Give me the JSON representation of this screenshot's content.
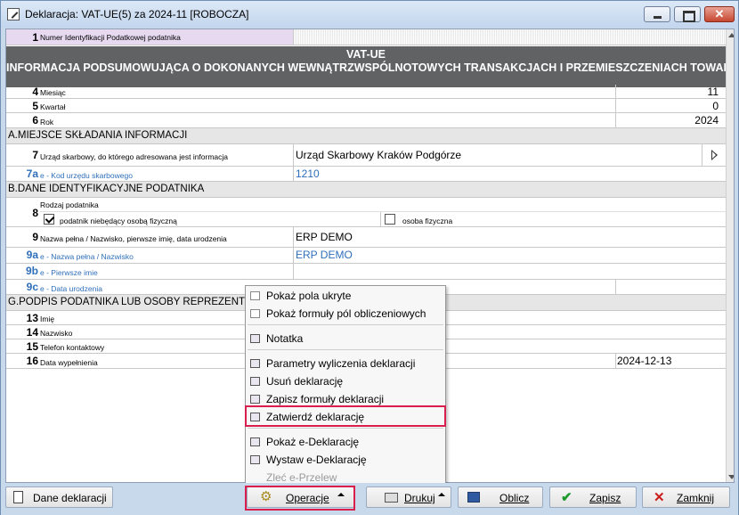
{
  "window": {
    "title": "Deklaracja: VAT-UE(5) za 2024-11  [ROBOCZA]"
  },
  "form": {
    "row1": {
      "num": "1",
      "label": "Numer Identyfikacji Podatkowej podatnika"
    },
    "header_title": "VAT-UE",
    "header_subtitle": "INFORMACJA PODSUMOWUJĄCA O DOKONANYCH WEWNĄTRZWSPÓLNOTOWYCH TRANSAKCJACH I PRZEMIESZCZENIACH TOWARÓW W",
    "row4": {
      "num": "4",
      "label": "Miesiąc",
      "value": "11"
    },
    "row5": {
      "num": "5",
      "label": "Kwartał",
      "value": "0"
    },
    "row6": {
      "num": "6",
      "label": "Rok",
      "value": "2024"
    },
    "section_a": "A.MIEJSCE SKŁADANIA INFORMACJI",
    "row7": {
      "num": "7",
      "label": "Urząd skarbowy, do którego adresowana jest informacja",
      "value": "Urząd Skarbowy Kraków Podgórze"
    },
    "row7a": {
      "num": "7a",
      "label": "e - Kod urzędu skarbowego",
      "value": "1210"
    },
    "section_b": "B.DANE IDENTYFIKACYJNE PODATNIKA",
    "row8": {
      "num": "8",
      "label": "Rodzaj podatnika",
      "option1": "podatnik niebędący osobą fizyczną",
      "option1_checked": true,
      "option2": "osoba fizyczna",
      "option2_checked": false
    },
    "row9": {
      "num": "9",
      "label": "Nazwa pełna / Nazwisko, pierwsze imię, data urodzenia",
      "value": "ERP DEMO"
    },
    "row9a": {
      "num": "9a",
      "label": "e - Nazwa pełna / Nazwisko",
      "value": "ERP DEMO"
    },
    "row9b": {
      "num": "9b",
      "label": "e - Pierwsze imie",
      "value": ""
    },
    "row9c": {
      "num": "9c",
      "label": "e - Data urodzenia",
      "value": ""
    },
    "section_g": "G.PODPIS PODATNIKA LUB OSOBY REPREZENTUJ",
    "row13": {
      "num": "13",
      "label": "Imię"
    },
    "row14": {
      "num": "14",
      "label": "Nazwisko"
    },
    "row15": {
      "num": "15",
      "label": "Telefon kontaktowy"
    },
    "row16": {
      "num": "16",
      "label": "Data wypełnienia",
      "value": "2024-12-13"
    }
  },
  "menu": {
    "items": [
      {
        "label": "Pokaż pola ukryte"
      },
      {
        "label": "Pokaż formuły pól obliczeniowych"
      },
      {
        "label": "Notatka"
      },
      {
        "label": "Parametry wyliczenia deklaracji"
      },
      {
        "label": "Usuń deklarację"
      },
      {
        "label": "Zapisz formuły deklaracji"
      },
      {
        "label": "Zatwierdź deklarację"
      },
      {
        "label": "Pokaż e-Deklarację"
      },
      {
        "label": "Wystaw e-Deklarację"
      },
      {
        "label": "Zleć e-Przelew"
      }
    ],
    "highlighted": "Zatwierdź deklarację",
    "highlight_color": "#d81f4e"
  },
  "toolbar": {
    "dane": "Dane deklaracji",
    "operacje": "Operacje",
    "drukuj": "Drukuj",
    "oblicz": "Oblicz",
    "zapisz": "Zapisz",
    "zamknij": "Zamknij"
  }
}
